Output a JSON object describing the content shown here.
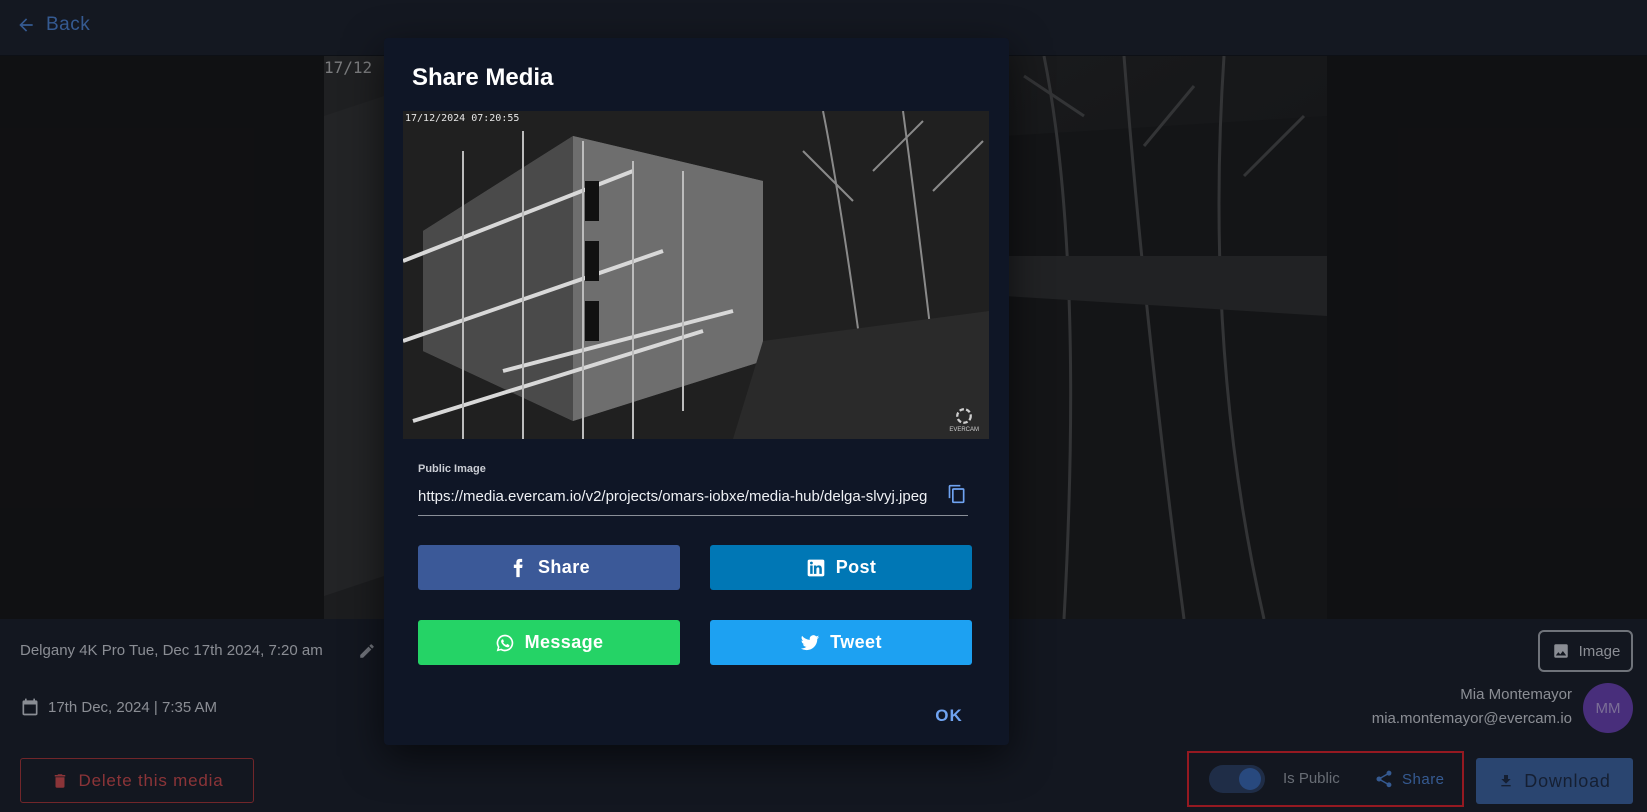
{
  "topbar": {
    "back_label": "Back"
  },
  "viewer": {
    "timestamp": "17/12"
  },
  "info": {
    "title": "Delgany 4K Pro Tue, Dec 17th 2024, 7:20 am",
    "date": "17th Dec, 2024 | 7:35 AM",
    "delete_label": "Delete this media",
    "image_label": "Image"
  },
  "user": {
    "name": "Mia Montemayor",
    "email": "mia.montemayor@evercam.io",
    "initials": "MM"
  },
  "actions": {
    "is_public_label": "Is Public",
    "is_public": true,
    "share_label": "Share",
    "download_label": "Download"
  },
  "dialog": {
    "title": "Share Media",
    "preview_timestamp": "17/12/2024 07:20:55",
    "preview_logo": "EVERCAM",
    "field_label": "Public Image",
    "url_value": "https://media.evercam.io/v2/projects/omars-iobxe/media-hub/delga-slvyj.jpeg",
    "buttons": {
      "facebook": "Share",
      "linkedin": "Post",
      "whatsapp": "Message",
      "twitter": "Tweet"
    },
    "ok_label": "OK"
  },
  "colors": {
    "accent": "#4d84d6",
    "facebook": "#3b5998",
    "linkedin": "#0077b5",
    "whatsapp": "#25d366",
    "twitter": "#1da1f2",
    "danger": "#d14a4d",
    "highlight": "#e0212a"
  }
}
